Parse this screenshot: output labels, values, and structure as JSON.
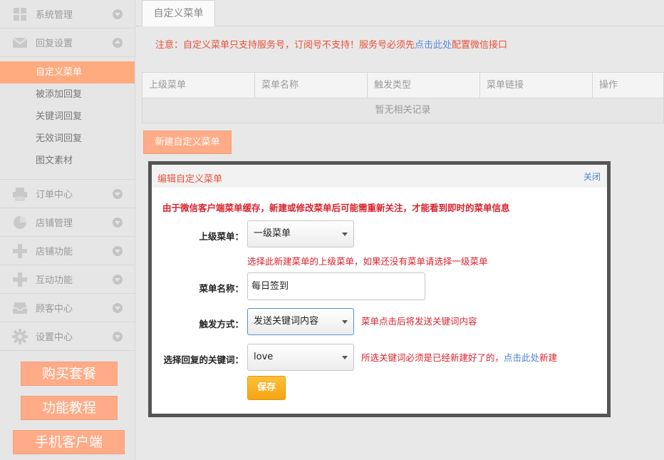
{
  "sidebar": {
    "groups_top": [
      {
        "label": "系统管理",
        "icon": "grid-icon"
      },
      {
        "label": "回复设置",
        "icon": "envelope-icon"
      }
    ],
    "sub_items": [
      "自定义菜单",
      "被添加回复",
      "关键词回复",
      "无效词回复",
      "图文素材"
    ],
    "groups_bottom": [
      {
        "label": "订单中心",
        "icon": "printer-icon"
      },
      {
        "label": "店铺管理",
        "icon": "pie-chart-icon"
      },
      {
        "label": "店铺功能",
        "icon": "plus-icon"
      },
      {
        "label": "互动功能",
        "icon": "plus-icon"
      },
      {
        "label": "顾客中心",
        "icon": "inbox-icon"
      },
      {
        "label": "设置中心",
        "icon": "gear-icon"
      }
    ],
    "buttons": [
      "购买套餐",
      "功能教程",
      "手机客户端"
    ]
  },
  "main": {
    "tab": "自定义菜单",
    "notice_prefix": "注意：自定义菜单只支持服务号，订阅号不支持！服务号必须先",
    "notice_link": "点击此处",
    "notice_suffix": "配置微信接口",
    "table": {
      "columns": [
        "上级菜单",
        "菜单名称",
        "触发类型",
        "菜单链接",
        "操作"
      ],
      "empty_text": "暂无相关记录"
    },
    "new_button": "新建自定义菜单"
  },
  "dialog": {
    "title": "编辑自定义菜单",
    "close": "关闭",
    "warning": "由于微信客户端菜单缓存，新建或修改菜单后可能需重新关注，才能看到即时的菜单信息",
    "parent_label": "上级菜单：",
    "parent_value": "一级菜单",
    "parent_hint": "选择此新建菜单的上级菜单，如果还没有菜单请选择一级菜单",
    "name_label": "菜单名称：",
    "name_value": "每日签到",
    "trigger_label": "触发方式：",
    "trigger_value": "发送关键词内容",
    "trigger_hint": "菜单点击后将发送关键词内容",
    "keyword_label": "选择回复的关键词：",
    "keyword_value": "love",
    "keyword_hint_prefix": "所选关键词必须是已经新建好了的，",
    "keyword_hint_link": "点击此处",
    "keyword_hint_suffix": "新建",
    "save": "保存"
  },
  "colors": {
    "accent": "#ffab87",
    "warning_red": "#d9232e",
    "link_blue": "#4d7fd0",
    "save_orange": "#f5a512"
  }
}
